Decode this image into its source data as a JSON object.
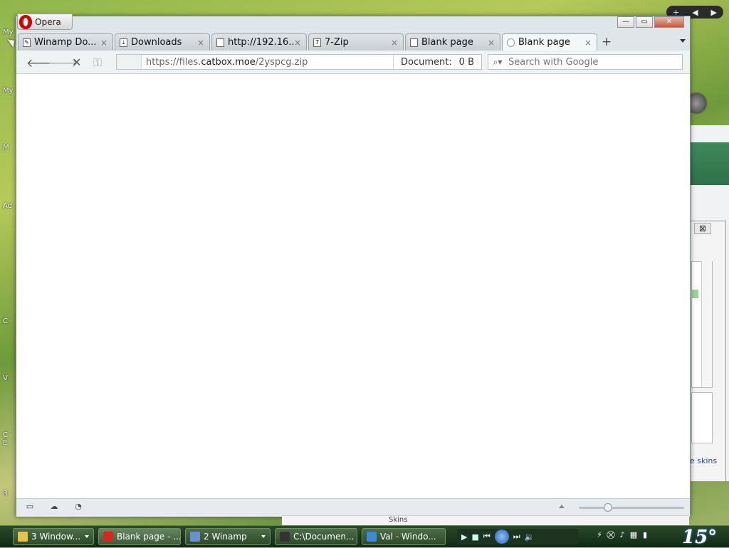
{
  "window": {
    "app_label": "Opera",
    "controls": {
      "minimize": "—",
      "maximize": "▭",
      "close": "✕"
    }
  },
  "tabs": [
    {
      "title": "Winamp Do...",
      "close": "×",
      "icon": "edit-icon",
      "active": false
    },
    {
      "title": "Downloads",
      "close": "×",
      "icon": "download-icon",
      "active": false
    },
    {
      "title": "http://192.16...",
      "close": "×",
      "icon": "page-icon",
      "active": false
    },
    {
      "title": "7-Zip",
      "close": "×",
      "icon": "7zip-icon",
      "active": false
    },
    {
      "title": "Blank page",
      "close": "×",
      "icon": "page-icon",
      "active": false
    },
    {
      "title": "Blank page",
      "close": "×",
      "icon": "loading-icon",
      "active": true
    }
  ],
  "toolbar": {
    "back": "🡐",
    "forward": "🡒",
    "stop": "✕",
    "key": "⚿",
    "url_prefix": "https://files.",
    "url_domain": "catbox.moe",
    "url_path": "/2yspcg.zip",
    "document_label": "Document:",
    "document_size": "0 B",
    "search_placeholder": "Search with Google"
  },
  "status_bar": {
    "panel_icon": "▭",
    "cloud_icon": "☁",
    "speed_icon": "◔",
    "zoom_level": 0.28
  },
  "background": {
    "desktop_labels": [
      "My",
      "My",
      "M",
      "Ad",
      "C",
      "V",
      "C\nE",
      "R"
    ],
    "bottom_strip_text": "Skins",
    "link_text": "e skins"
  },
  "taskbar": {
    "items": [
      {
        "label": "3 Window...",
        "icon": "folder-icon",
        "icon_color": "#e8c14a",
        "active": false
      },
      {
        "label": "Blank page - ...",
        "icon": "opera-icon",
        "icon_color": "#d2281e",
        "active": true
      },
      {
        "label": "2 Winamp",
        "icon": "winamp-icon",
        "icon_color": "#6c8fd0",
        "active": false
      },
      {
        "label": "C:\\Documen...",
        "icon": "7zip-icon",
        "icon_color": "#333333",
        "active": false
      },
      {
        "label": "Val - Windo...",
        "icon": "ie-icon",
        "icon_color": "#3b8ad8",
        "active": false
      }
    ],
    "clock": "15°"
  }
}
